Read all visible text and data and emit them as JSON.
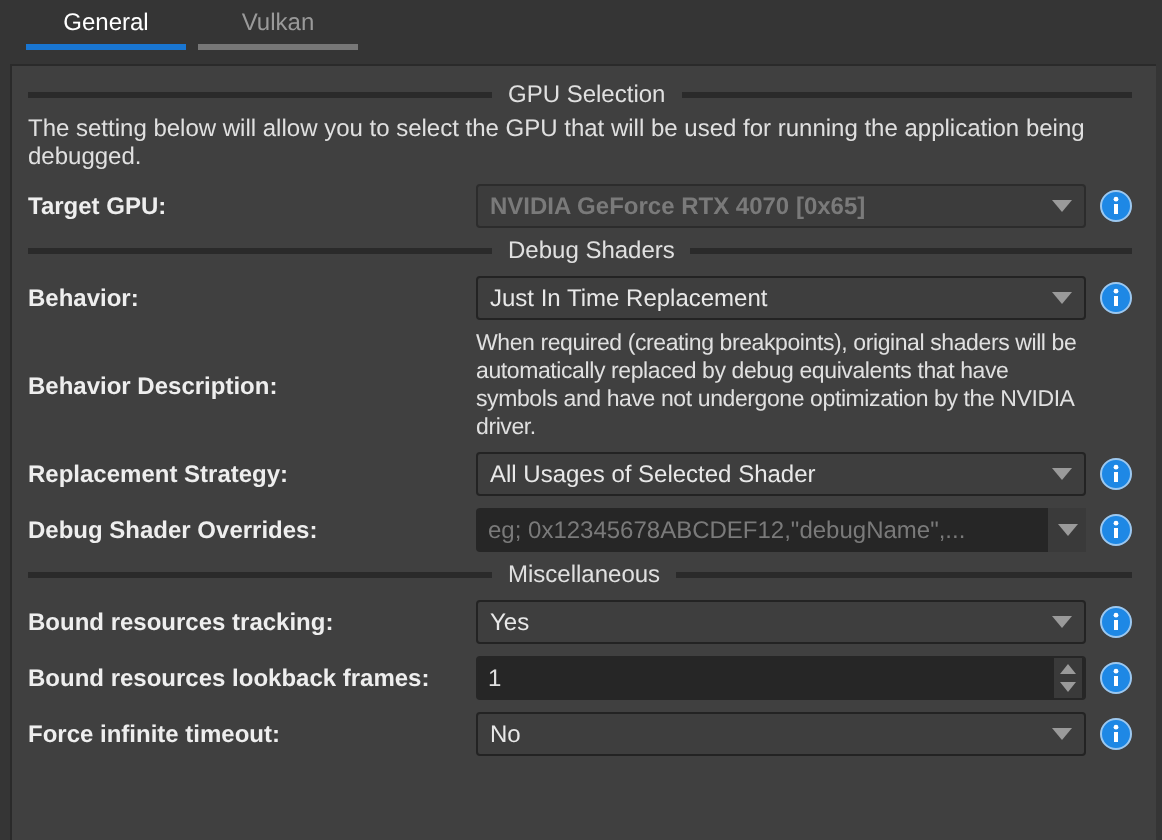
{
  "tabs": [
    {
      "label": "General",
      "selected": true
    },
    {
      "label": "Vulkan",
      "selected": false
    }
  ],
  "sections": [
    {
      "title": "GPU Selection",
      "intro": "The setting below will allow you to select the GPU that will be used for running the application being debugged.",
      "rows": [
        {
          "kind": "dropdown",
          "label": "Target GPU:",
          "value": "NVIDIA GeForce RTX 4070 [0x65]",
          "disabled": true
        }
      ]
    },
    {
      "title": "Debug Shaders",
      "rows": [
        {
          "kind": "dropdown",
          "label": "Behavior:",
          "value": "Just In Time Replacement",
          "disabled": false
        },
        {
          "kind": "text",
          "label": "Behavior Description:",
          "value": "When required (creating breakpoints), original shaders will be automatically replaced by debug equivalents that have symbols and have not undergone optimization by the NVIDIA driver."
        },
        {
          "kind": "dropdown",
          "label": "Replacement Strategy:",
          "value": "All Usages of Selected Shader",
          "disabled": false
        },
        {
          "kind": "combo",
          "label": "Debug Shader Overrides:",
          "placeholder": "eg; 0x12345678ABCDEF12,\"debugName\",..."
        }
      ]
    },
    {
      "title": "Miscellaneous",
      "rows": [
        {
          "kind": "dropdown",
          "label": "Bound resources tracking:",
          "value": "Yes",
          "disabled": false
        },
        {
          "kind": "spin",
          "label": "Bound resources lookback frames:",
          "value": "1"
        },
        {
          "kind": "dropdown",
          "label": "Force infinite timeout:",
          "value": "No",
          "disabled": false
        }
      ]
    }
  ]
}
